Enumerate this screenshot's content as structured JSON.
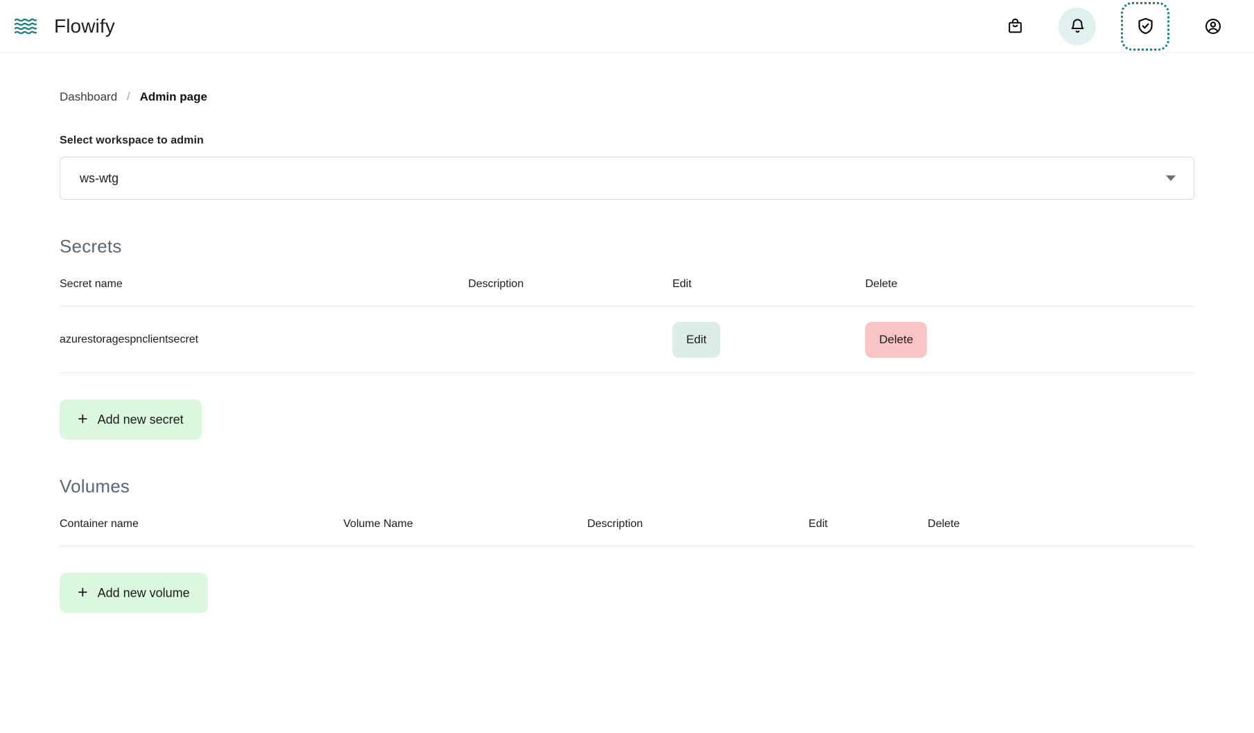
{
  "header": {
    "brand_title": "Flowify",
    "logo_icon": "waves-icon",
    "actions": [
      {
        "name": "shopping-bag-icon",
        "label": "Shop",
        "tinted": false,
        "focused": false
      },
      {
        "name": "bell-icon",
        "label": "Notifications",
        "tinted": true,
        "focused": false
      },
      {
        "name": "shield-check-icon",
        "label": "Security",
        "tinted": false,
        "focused": true
      },
      {
        "name": "account-circle-icon",
        "label": "Account",
        "tinted": false,
        "focused": false
      }
    ]
  },
  "breadcrumb": {
    "parent": "Dashboard",
    "separator": "/",
    "current": "Admin page"
  },
  "workspace_select": {
    "label": "Select workspace to admin",
    "value": "ws-wtg",
    "arrow_icon": "chevron-down-icon"
  },
  "secrets": {
    "title": "Secrets",
    "columns": [
      "Secret name",
      "Description",
      "Edit",
      "Delete"
    ],
    "rows": [
      {
        "secret_name": "azurestoragespnclientsecret",
        "description": "",
        "edit_label": "Edit",
        "delete_label": "Delete"
      }
    ],
    "add_button": {
      "label": "Add new secret",
      "icon": "plus-icon",
      "glyph": "+"
    }
  },
  "volumes": {
    "title": "Volumes",
    "columns": [
      "Container name",
      "Volume Name",
      "Description",
      "Edit",
      "Delete"
    ],
    "rows": [],
    "add_button": {
      "label": "Add new volume",
      "icon": "plus-icon",
      "glyph": "+"
    }
  },
  "colors": {
    "brand_teal": "#1a7f82",
    "bell_tint": "#e0f0ee",
    "edit_button": "#dcece9",
    "delete_button": "#fbc4c4",
    "add_button": "#dcf7e0",
    "section_title": "#5b6670"
  }
}
